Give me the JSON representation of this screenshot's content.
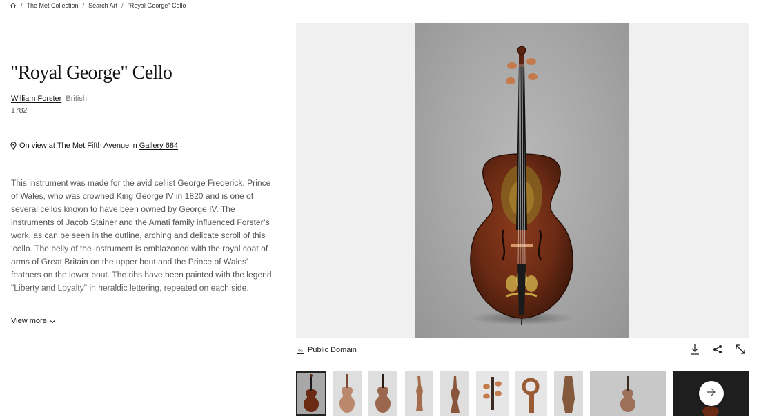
{
  "breadcrumb": {
    "home_icon": "home-icon",
    "items": [
      "The Met Collection",
      "Search Art",
      "\"Royal George\" Cello"
    ],
    "separator": "/"
  },
  "artwork": {
    "title": "\"Royal George\" Cello",
    "artist": "William Forster",
    "nationality": "British",
    "date": "1782",
    "on_view_prefix": "On view at The Met Fifth Avenue in",
    "gallery": "Gallery 684",
    "description": "This instrument was made for the avid cellist George Frederick, Prince of Wales, who was crowned King George IV in 1820 and is one of several cellos known to have been owned by George IV. The instruments of Jacob Stainer and the Amati family influenced Forster’s work, as can be seen in the outline, arching and delicate scroll of this ‘cello. The belly of the instrument is emblazoned with the royal coat of arms of Great Britain on the upper bout and the Prince of Wales' feathers on the lower bout. The ribs have been painted with the legend \"Liberty and Loyalty\" in heraldic lettering, repeated on each side.",
    "view_more": "View more"
  },
  "image": {
    "license": "Public Domain",
    "license_icon": "public-domain-icon",
    "tools": [
      "download-icon",
      "share-icon",
      "expand-icon"
    ]
  },
  "thumbnails": {
    "count": 11,
    "active_index": 0,
    "next_icon": "arrow-right-icon"
  },
  "colors": {
    "text": "#222222",
    "muted": "#555555",
    "viewer_bg": "#f0f0f0",
    "wood": "#6a2a14"
  }
}
